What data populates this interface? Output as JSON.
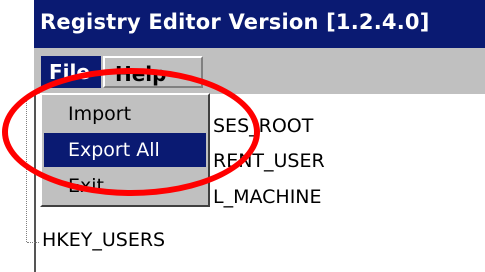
{
  "window": {
    "title": "Registry Editor Version [1.2.4.0]"
  },
  "menubar": {
    "items": [
      "File",
      "Help"
    ]
  },
  "file_menu": {
    "items": [
      {
        "label": "Import",
        "selected": false
      },
      {
        "label": "Export All",
        "selected": true
      },
      {
        "label": "Exit",
        "selected": false
      }
    ]
  },
  "tree": {
    "nodes": [
      "HKEY_CLASSES_ROOT",
      "HKEY_CURRENT_USER",
      "HKEY_LOCAL_MACHINE",
      "HKEY_USERS"
    ],
    "visible_fragments": [
      "SES_ROOT",
      "RENT_USER",
      "L_MACHINE",
      "HKEY_USERS"
    ]
  },
  "annotation": {
    "shape": "ellipse",
    "color": "#ff0000"
  },
  "colors": {
    "titlebar": "#0a1a72",
    "selection": "#0a1a72",
    "menu_bg": "#c0c0c0"
  }
}
